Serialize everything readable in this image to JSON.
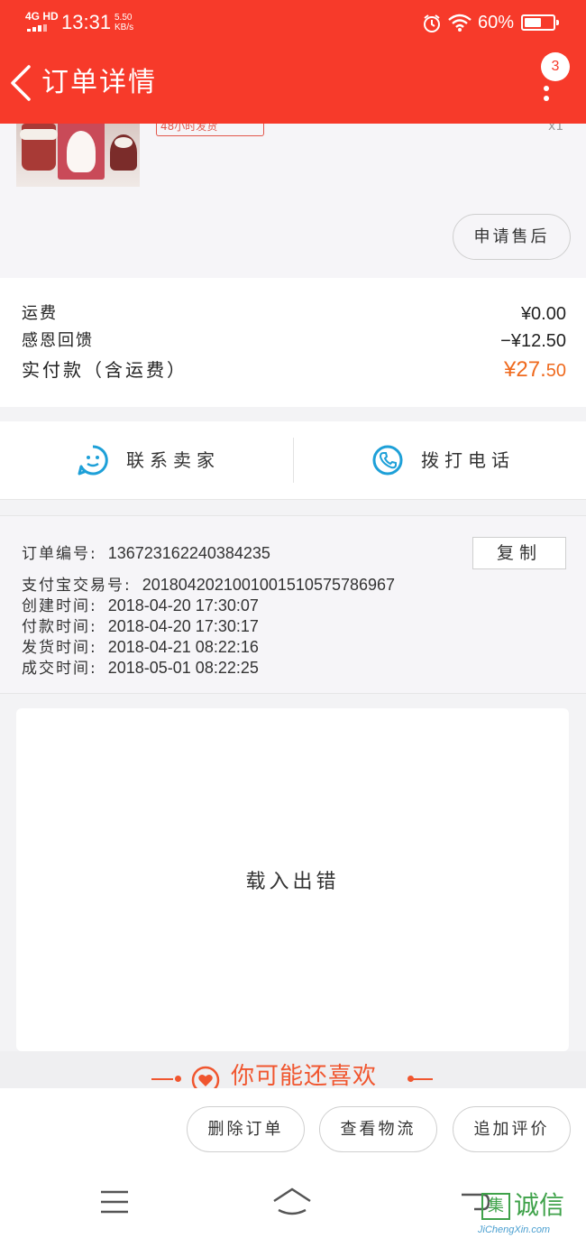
{
  "status_bar": {
    "network": "4G HD",
    "time": "13:31",
    "speed_value": "5.50",
    "speed_unit": "KB/s",
    "battery_percent": "60%",
    "battery_level": 0.6
  },
  "header": {
    "title": "订单详情",
    "badge_count": "3",
    "background_color": "#f73a2a"
  },
  "product": {
    "tag_text": "48小时发货",
    "quantity": "x1",
    "after_sale_label": "申请售后"
  },
  "summary": {
    "shipping_label": "运费",
    "shipping_value": "¥0.00",
    "reward_label": "感恩回馈",
    "reward_value": "−¥12.50",
    "paid_label": "实付款（含运费）",
    "paid_value_main": "¥27.",
    "paid_value_cents": "50",
    "paid_color": "#ef6a1e"
  },
  "contact": {
    "seller_label": "联系卖家",
    "phone_label": "拨打电话",
    "icon_color": "#1ea0d8"
  },
  "order_info": {
    "order_no_label": "订单编号:",
    "order_no": "136723162240384235",
    "copy_label": "复制",
    "alipay_label": "支付宝交易号:",
    "alipay_no": "2018042021001001510575786967",
    "created_label": "创建时间:",
    "created_time": "2018-04-20 17:30:07",
    "paid_label": "付款时间:",
    "paid_time": "2018-04-20 17:30:17",
    "shipped_label": "发货时间:",
    "shipped_time": "2018-04-21 08:22:16",
    "completed_label": "成交时间:",
    "completed_time": "2018-05-01 08:22:25"
  },
  "error_panel": {
    "message": "载入出错"
  },
  "recommend": {
    "title": "你可能还喜欢",
    "accent_color": "#f0562f"
  },
  "actions": {
    "delete_label": "删除订单",
    "logistics_label": "查看物流",
    "review_label": "追加评价"
  },
  "watermark": {
    "logo_char": "集",
    "cn": "诚信",
    "en": "JiChengXin.com"
  }
}
